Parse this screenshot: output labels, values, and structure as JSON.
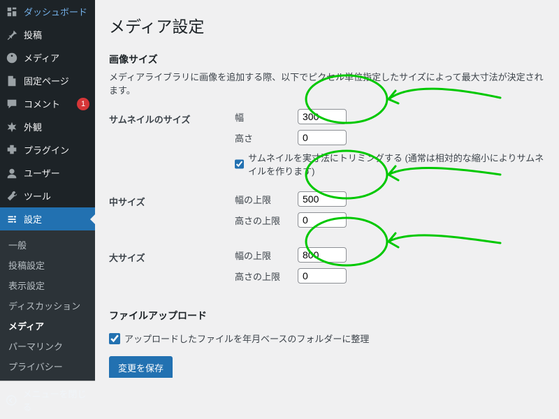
{
  "sidebar": {
    "items": [
      {
        "icon": "dashboard-icon",
        "label": "ダッシュボード"
      },
      {
        "icon": "pin-icon",
        "label": "投稿"
      },
      {
        "icon": "media-icon",
        "label": "メディア"
      },
      {
        "icon": "page-icon",
        "label": "固定ページ"
      },
      {
        "icon": "comment-icon",
        "label": "コメント",
        "badge": "1"
      },
      {
        "icon": "appearance-icon",
        "label": "外観"
      },
      {
        "icon": "plugin-icon",
        "label": "プラグイン"
      },
      {
        "icon": "user-icon",
        "label": "ユーザー"
      },
      {
        "icon": "tools-icon",
        "label": "ツール"
      },
      {
        "icon": "settings-icon",
        "label": "設定",
        "active": true
      }
    ],
    "submenu": [
      {
        "label": "一般"
      },
      {
        "label": "投稿設定"
      },
      {
        "label": "表示設定"
      },
      {
        "label": "ディスカッション"
      },
      {
        "label": "メディア",
        "current": true
      },
      {
        "label": "パーマリンク"
      },
      {
        "label": "プライバシー"
      }
    ],
    "collapse": "メニューを閉じる"
  },
  "page": {
    "title": "メディア設定",
    "section_image_sizes": "画像サイズ",
    "section_image_desc": "メディアライブラリに画像を追加する際、以下でピクセル単位指定したサイズによって最大寸法が決定されます。",
    "thumb": {
      "heading": "サムネイルのサイズ",
      "width_label": "幅",
      "width_value": "300",
      "height_label": "高さ",
      "height_value": "0",
      "crop_label": "サムネイルを実寸法にトリミングする (通常は相対的な縮小によりサムネイルを作ります)",
      "crop_checked": true
    },
    "medium": {
      "heading": "中サイズ",
      "width_label": "幅の上限",
      "width_value": "500",
      "height_label": "高さの上限",
      "height_value": "0"
    },
    "large": {
      "heading": "大サイズ",
      "width_label": "幅の上限",
      "width_value": "800",
      "height_label": "高さの上限",
      "height_value": "0"
    },
    "section_upload": "ファイルアップロード",
    "upload_check_label": "アップロードしたファイルを年月ベースのフォルダーに整理",
    "upload_checked": true,
    "save_button": "変更を保存"
  },
  "annotations": {
    "color": "#00c800"
  }
}
